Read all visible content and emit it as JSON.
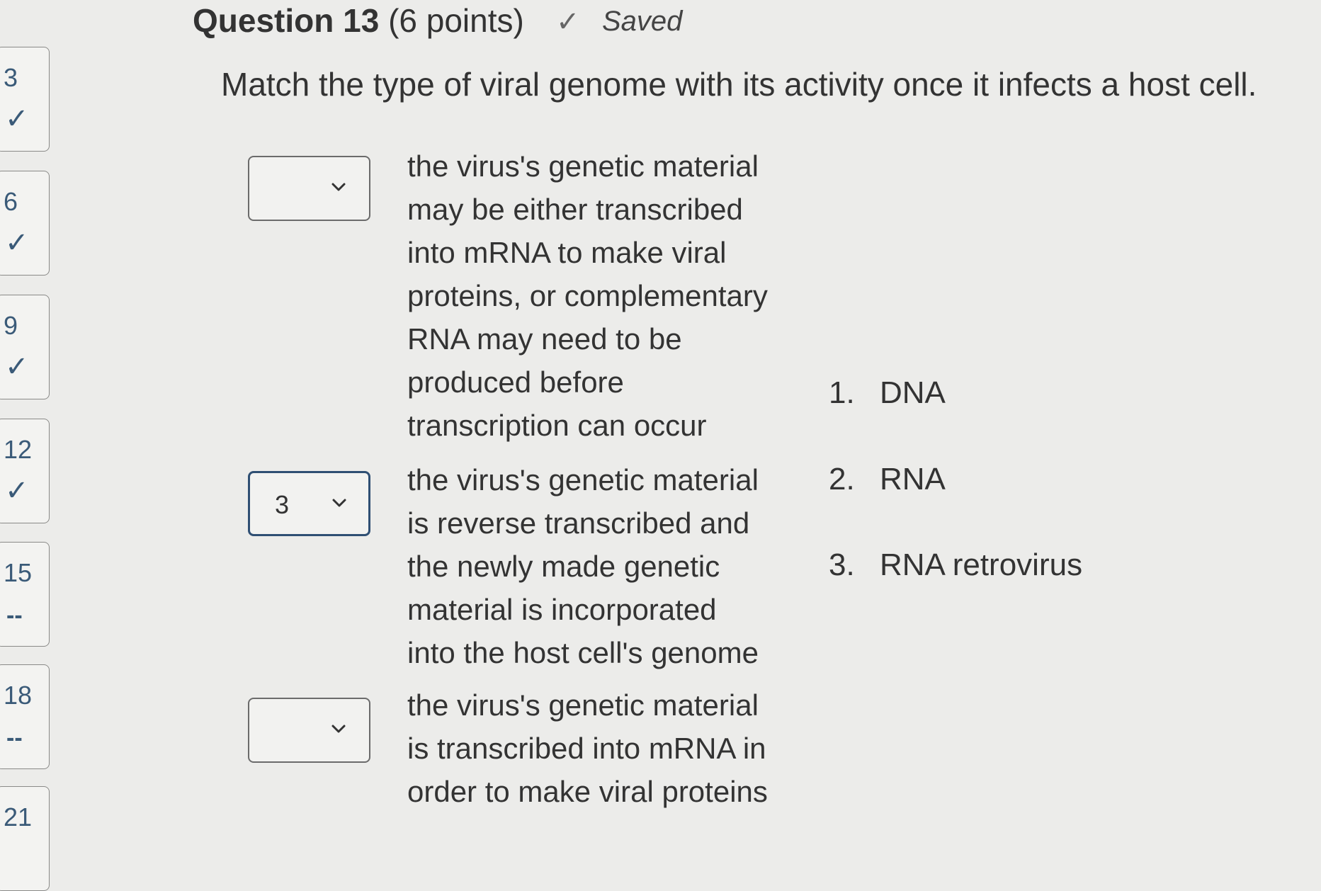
{
  "nav": {
    "items": [
      {
        "number": "3",
        "status": "✓"
      },
      {
        "number": "6",
        "status": "✓"
      },
      {
        "number": "9",
        "status": "✓"
      },
      {
        "number": "12",
        "status": "✓"
      },
      {
        "number": "15",
        "status": "--"
      },
      {
        "number": "18",
        "status": "--"
      },
      {
        "number": "21",
        "status": ""
      }
    ]
  },
  "question": {
    "title": "Question 13",
    "points": "(6 points)",
    "saved_label": "Saved",
    "prompt": "Match the type of viral genome with its activity once it infects a host cell."
  },
  "matches": [
    {
      "selected": "",
      "lines": [
        "the virus's genetic material",
        "may be either transcribed",
        "into mRNA to make viral",
        "proteins, or complementary",
        "RNA may need to be",
        "produced before",
        "transcription can occur"
      ]
    },
    {
      "selected": "3",
      "lines": [
        "the virus's genetic material",
        "is reverse transcribed and",
        "the newly made genetic",
        "material is incorporated",
        "into the host cell's genome"
      ]
    },
    {
      "selected": "",
      "lines": [
        "the virus's genetic material",
        "is transcribed into mRNA in",
        "order to make viral proteins"
      ]
    }
  ],
  "options": [
    {
      "number": "1.",
      "label": "DNA"
    },
    {
      "number": "2.",
      "label": "RNA"
    },
    {
      "number": "3.",
      "label": "RNA retrovirus"
    }
  ],
  "colors": {
    "nav_accent": "#3a5a78",
    "selected_border": "#2f4f73"
  }
}
